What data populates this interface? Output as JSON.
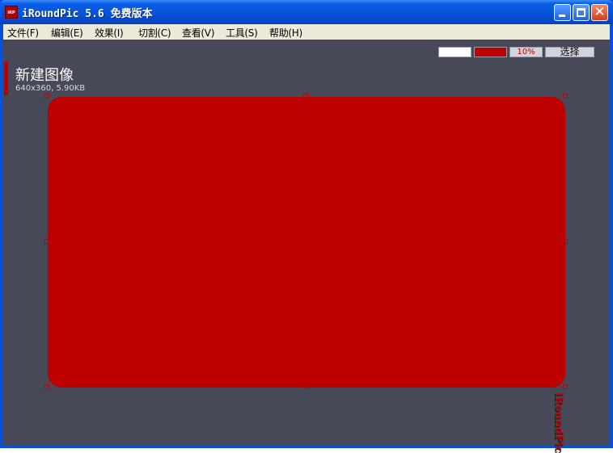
{
  "window": {
    "title": "iRoundPic 5.6 免费版本",
    "app_icon_text": "iRP"
  },
  "menu": {
    "items": [
      {
        "label": "文件(F)"
      },
      {
        "label": "编辑(E)"
      },
      {
        "label": "效果(I)"
      },
      {
        "label": "切割(C)"
      },
      {
        "label": "查看(V)"
      },
      {
        "label": "工具(S)"
      },
      {
        "label": "帮助(H)"
      }
    ]
  },
  "toolbar": {
    "background_color": "#ffffff",
    "corner_color": "#bd0000",
    "radius_percent": "10%",
    "select_label": "选择"
  },
  "image": {
    "title": "新建图像",
    "meta": "640x360, 5.90KB"
  },
  "logo_text": "iRoundPic",
  "colors": {
    "accent": "#bd0000",
    "workspace": "#474959",
    "titlebar": "#0a5ee8"
  }
}
